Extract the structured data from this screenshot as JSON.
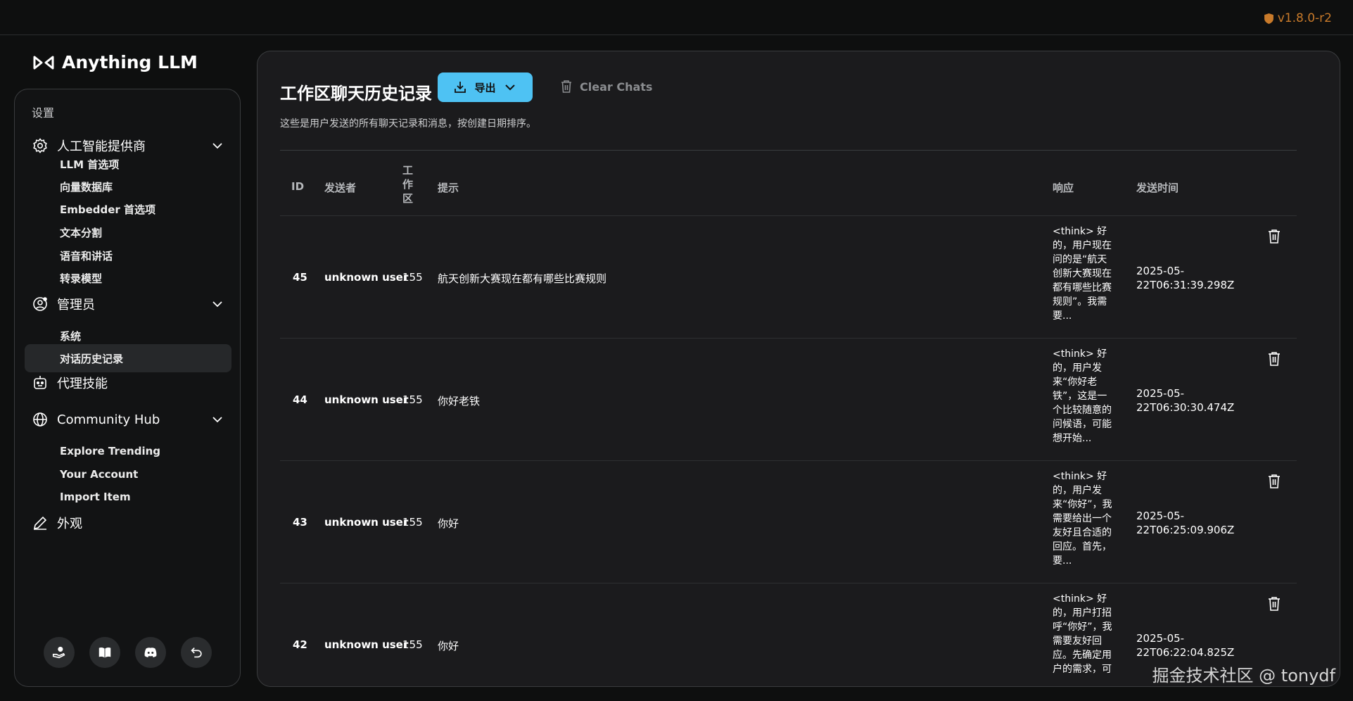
{
  "app": {
    "version": "v1.8.0-r2",
    "logo_text": "Anything LLM"
  },
  "sidebar": {
    "heading": "设置",
    "groups": [
      {
        "label": "人工智能提供商",
        "icon": "gear-icon",
        "items": [
          "LLM 首选项",
          "向量数据库",
          "Embedder 首选项",
          "文本分割",
          "语音和讲话",
          "转录模型"
        ]
      },
      {
        "label": "管理员",
        "icon": "user-circle-gear-icon",
        "items": [
          "系统",
          "对话历史记录"
        ]
      },
      {
        "label": "代理技能",
        "icon": "robot-icon",
        "items": []
      },
      {
        "label": "Community Hub",
        "icon": "globe-icon",
        "items": [
          "Explore Trending",
          "Your Account",
          "Import Item"
        ]
      },
      {
        "label": "外观",
        "icon": "pencil-icon",
        "items": []
      }
    ],
    "active_item": "对话历史记录",
    "footer_icons": [
      "support-icon",
      "book-icon",
      "discord-icon",
      "back-arrow-icon"
    ]
  },
  "main": {
    "title": "工作区聊天历史记录",
    "export_label": "导出",
    "clear_label": "Clear Chats",
    "subtitle": "这些是用户发送的所有聊天记录和消息，按创建日期排序。",
    "columns": [
      "ID",
      "发送者",
      "工作区",
      "提示",
      "响应",
      "发送时间"
    ],
    "rows": [
      {
        "id": "45",
        "sender": "unknown user",
        "workspace": "155",
        "prompt": "航天创新大赛现在都有哪些比赛规则",
        "response": "<think> 好的，用户现在问的是“航天创新大赛现在都有哪些比赛规则”。我需要...",
        "sent_at": "2025-05-22T06:31:39.298Z"
      },
      {
        "id": "44",
        "sender": "unknown user",
        "workspace": "155",
        "prompt": "你好老铁",
        "response": "<think> 好的，用户发来“你好老铁”，这是一个比较随意的问候语，可能想开始...",
        "sent_at": "2025-05-22T06:30:30.474Z"
      },
      {
        "id": "43",
        "sender": "unknown user",
        "workspace": "155",
        "prompt": "你好",
        "response": "<think> 好的，用户发来“你好”，我需要给出一个友好且合适的回应。首先，要...",
        "sent_at": "2025-05-22T06:25:09.906Z"
      },
      {
        "id": "42",
        "sender": "unknown user",
        "workspace": "155",
        "prompt": "你好",
        "response": "<think> 好的，用户打招呼“你好”，我需要友好回应。先确定用户的需求，可",
        "sent_at": "2025-05-22T06:22:04.825Z"
      }
    ]
  },
  "watermark": "掘金技术社区 @ tonydf",
  "colors": {
    "accent": "#4ec2f3",
    "version": "#c87a2a",
    "panel": "#1b1b1d",
    "background": "#0e0f0f"
  }
}
